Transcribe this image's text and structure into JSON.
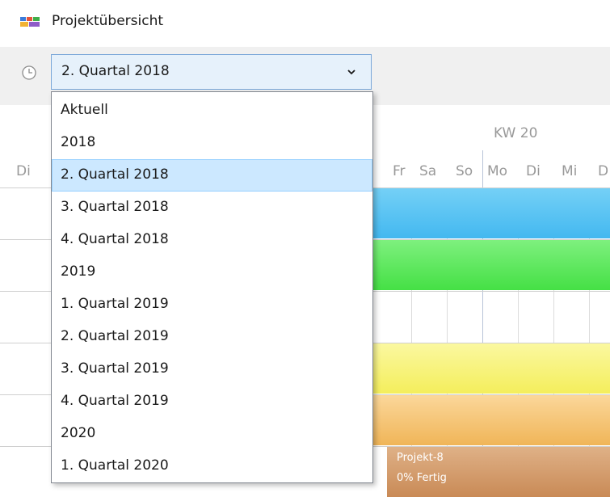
{
  "window": {
    "title": "Projektübersicht"
  },
  "toolbar": {
    "period_select": {
      "value": "2. Quartal 2018"
    }
  },
  "dropdown": {
    "selected_index": 2,
    "options": [
      "Aktuell",
      "2018",
      "2. Quartal 2018",
      "3. Quartal 2018",
      "4. Quartal 2018",
      "2019",
      "1. Quartal 2019",
      "2. Quartal 2019",
      "3. Quartal 2019",
      "4. Quartal 2019",
      "2020",
      "1. Quartal 2020"
    ]
  },
  "timeline": {
    "week_label": "KW 20",
    "days_left": [
      "Di"
    ],
    "days_right": [
      "Fr",
      "Sa",
      "So",
      "Mo",
      "Di",
      "Mi",
      "D"
    ]
  },
  "projects": [
    {
      "color": "#43b8f0"
    },
    {
      "color": "#45e045"
    },
    {
      "color": "#f4ee5c"
    },
    {
      "color": "#f0b558"
    },
    {
      "name": "Projekt-8",
      "progress": "0% Fertig",
      "color": "#c98a56"
    }
  ]
}
